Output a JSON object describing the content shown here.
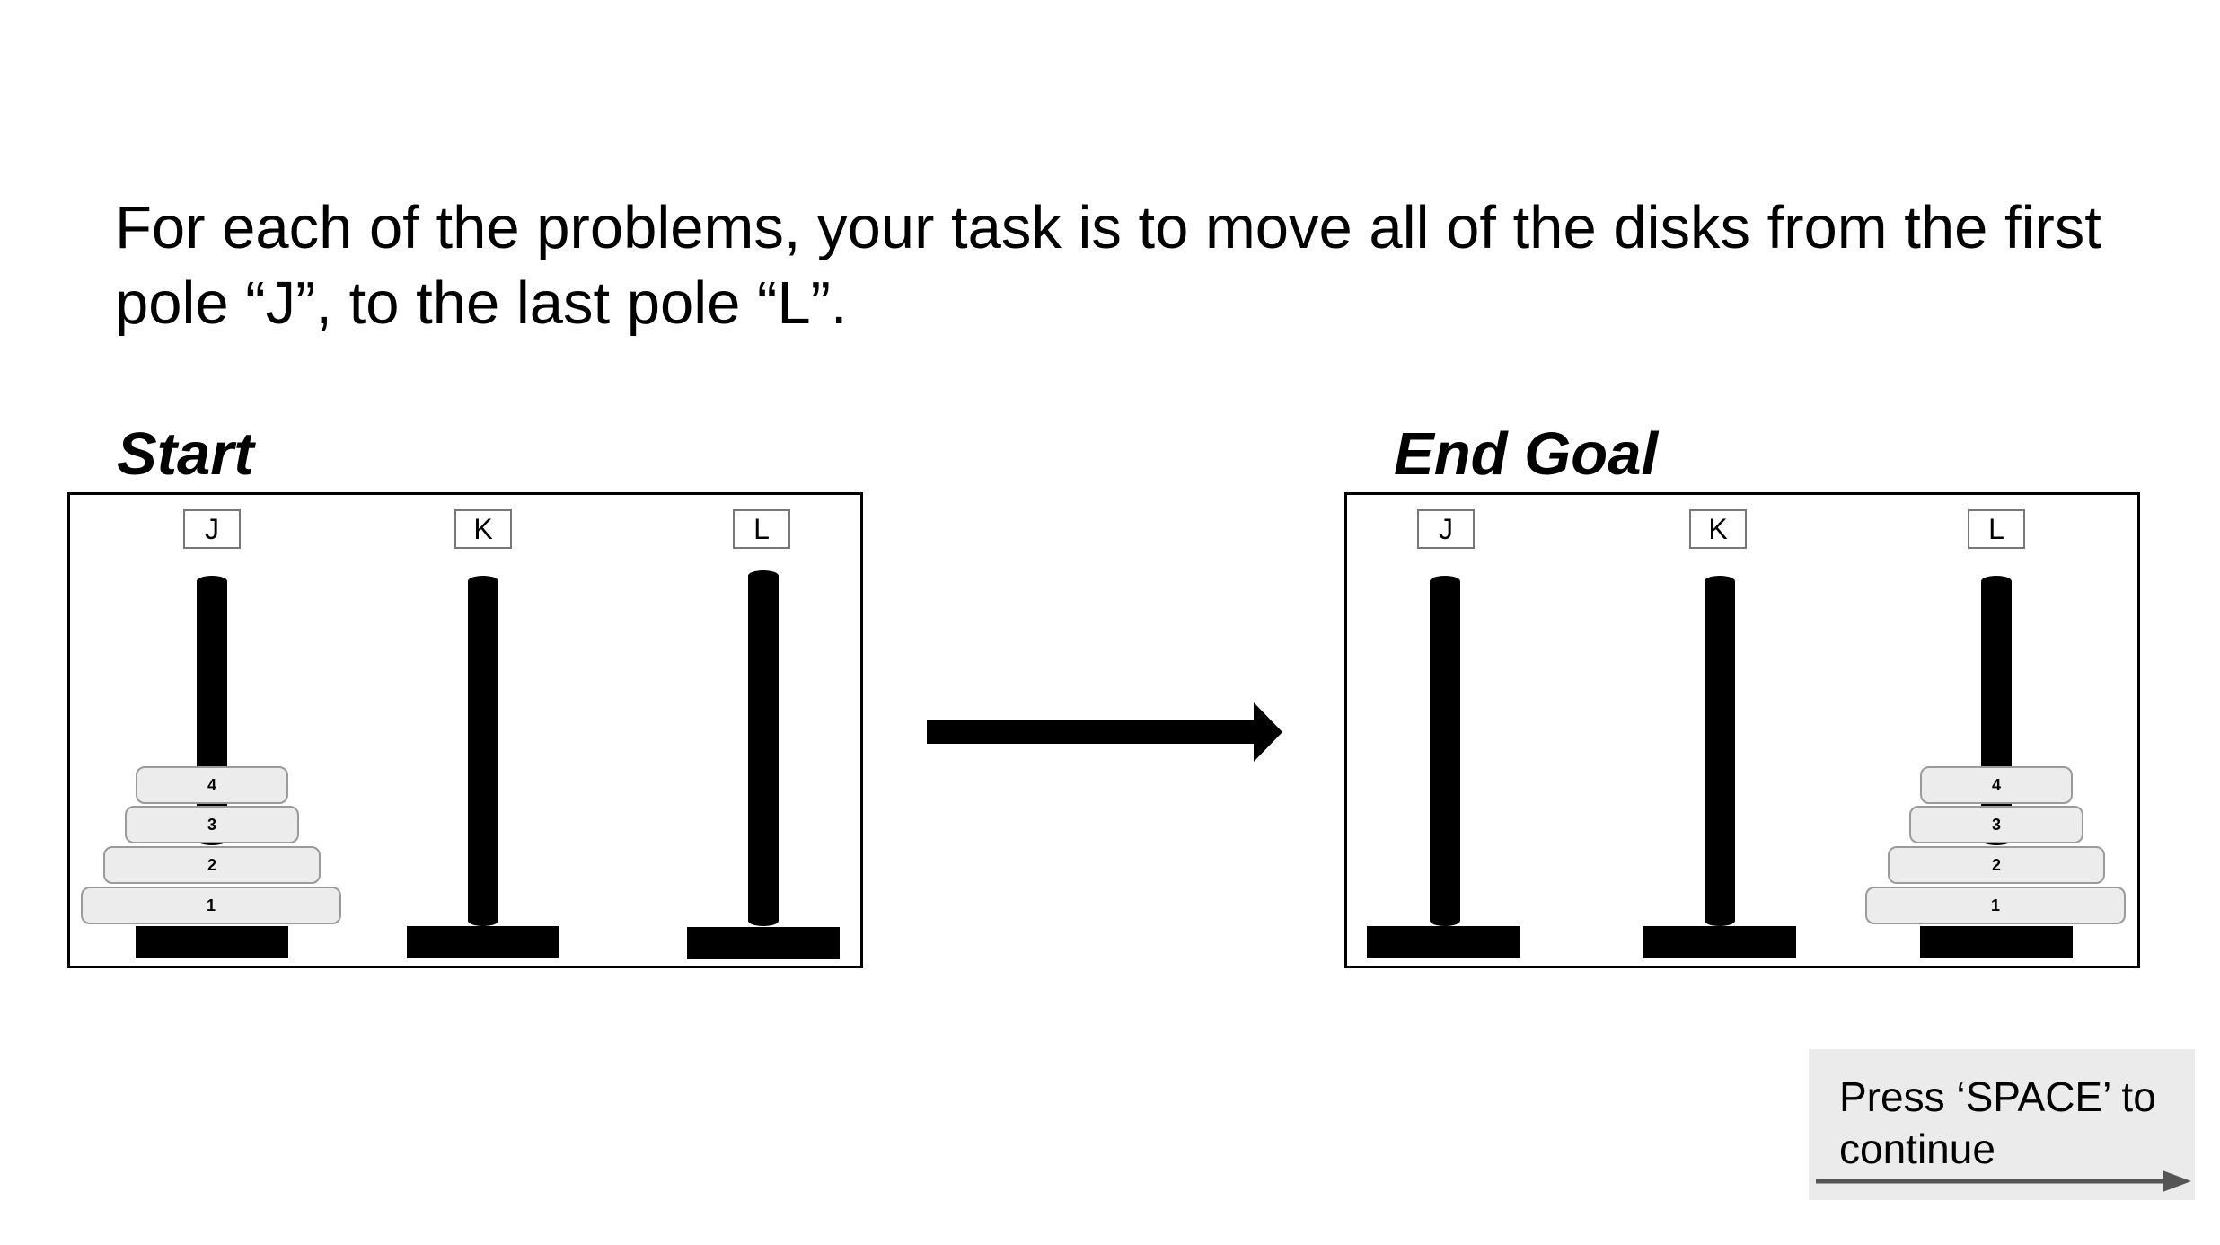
{
  "instructions": "For each of the problems, your task is to move all of the disks from the first pole “J”, to the last pole “L”.",
  "start_panel": {
    "title": "Start",
    "pegs": [
      {
        "label": "J",
        "disks": [
          "4",
          "3",
          "2",
          "1"
        ]
      },
      {
        "label": "K",
        "disks": []
      },
      {
        "label": "L",
        "disks": []
      }
    ]
  },
  "goal_panel": {
    "title": "End Goal",
    "pegs": [
      {
        "label": "J",
        "disks": []
      },
      {
        "label": "K",
        "disks": []
      },
      {
        "label": "L",
        "disks": [
          "4",
          "3",
          "2",
          "1"
        ]
      }
    ]
  },
  "continue_prompt": {
    "label": "Press ‘SPACE’ to continue"
  },
  "colors": {
    "disk_fill": "#ececec",
    "disk_border": "#9a9a9a",
    "button_bg": "#ebebeb",
    "arrow": "#555555"
  }
}
